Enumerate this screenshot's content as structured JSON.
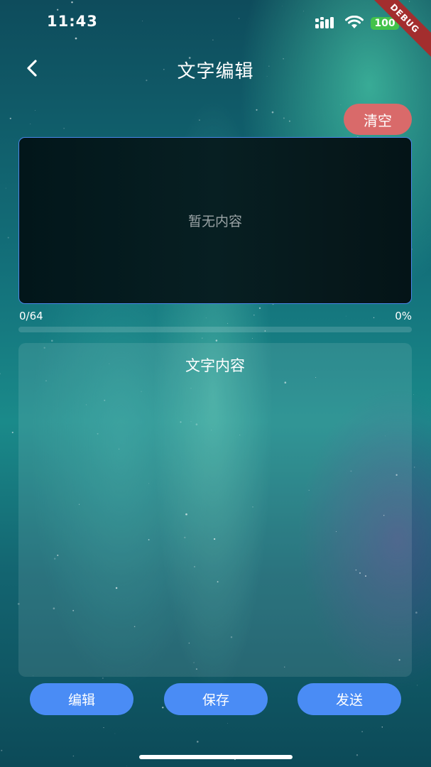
{
  "status_bar": {
    "time": "11:43",
    "battery": "100",
    "debug_label": "DEBUG",
    "icons": [
      "signal-icon",
      "wifi-icon",
      "battery-icon"
    ]
  },
  "header": {
    "back_icon": "chevron-left-icon",
    "title": "文字编辑"
  },
  "clear_button": {
    "label": "清空",
    "color": "#d96a6a"
  },
  "preview": {
    "empty_text": "暂无内容",
    "border_color": "#4a86e8"
  },
  "progress": {
    "count": "0/64",
    "percent": "0%",
    "fraction": 0
  },
  "content_panel": {
    "title": "文字内容"
  },
  "actions": {
    "edit_label": "编辑",
    "save_label": "保存",
    "send_label": "发送",
    "color": "#4a8cf5"
  }
}
